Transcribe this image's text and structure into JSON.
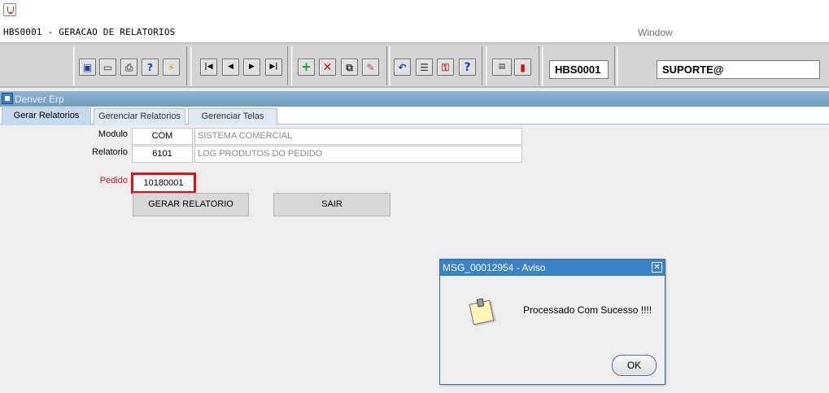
{
  "window": {
    "title": "HBS0001 - GERACAO DE RELATORIOS",
    "menu_window": "Window"
  },
  "toolbar": {
    "form_code": "HBS0001",
    "user": "SUPORTE@",
    "buttons": [
      {
        "icon": "save-icon"
      },
      {
        "icon": "window-icon"
      },
      {
        "icon": "print-icon"
      },
      {
        "icon": "query-icon"
      },
      {
        "icon": "execute-query-icon"
      },
      {
        "icon": "first-record-icon"
      },
      {
        "icon": "previous-record-icon"
      },
      {
        "icon": "next-record-icon"
      },
      {
        "icon": "last-record-icon"
      },
      {
        "icon": "insert-record-icon"
      },
      {
        "icon": "delete-record-icon"
      },
      {
        "icon": "duplicate-record-icon"
      },
      {
        "icon": "edit-icon"
      },
      {
        "icon": "undo-icon"
      },
      {
        "icon": "list-icon"
      },
      {
        "icon": "key-icon"
      },
      {
        "icon": "help-icon"
      },
      {
        "icon": "menu-icon"
      },
      {
        "icon": "exit-icon"
      }
    ]
  },
  "frame": {
    "title": "Denver Erp"
  },
  "tabs": [
    {
      "label": "Gerar Relatorios",
      "active": true
    },
    {
      "label": "Gerenciar Relatorios",
      "active": false
    },
    {
      "label": "Gerenciar Telas",
      "active": false
    }
  ],
  "form": {
    "modulo_label": "Modulo",
    "modulo_code": "COM",
    "modulo_desc": "SISTEMA COMERCIAL",
    "relatorio_label": "Relatorio",
    "relatorio_code": "6101",
    "relatorio_desc": "LOG PRODUTOS DO PEDIDO",
    "pedido_label": "Pedido",
    "pedido_value": "10180001",
    "gerar_label": "GERAR RELATORIO",
    "sair_label": "SAIR"
  },
  "colors": {
    "pedido_label": "#e0101a",
    "highlight_border": "#e0101a",
    "dialog_title_bg": "#3b82c8"
  },
  "dialog": {
    "title": "MSG_00012954 - Aviso",
    "message": "Processado Com Sucesso !!!!",
    "ok_label": "OK",
    "icon": "note-icon"
  }
}
